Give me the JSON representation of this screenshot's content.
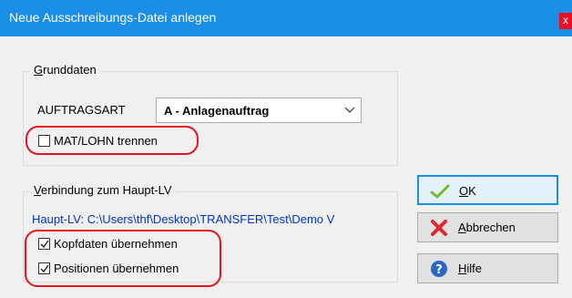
{
  "window": {
    "title": "Neue Ausschreibungs-Datei anlegen",
    "close_label": "x"
  },
  "grunddaten": {
    "legend_mnemonic": "G",
    "legend_rest": "runddaten",
    "auftragsart_label": "AUFTRAGSART",
    "auftragsart_value": "A - Anlagenauftrag",
    "mat_lohn_label": "MAT/LOHN trennen",
    "mat_lohn_checked": false
  },
  "verbindung": {
    "legend_mnemonic": "V",
    "legend_rest": "erbindung zum Haupt-LV",
    "haupt_lv_path": "Haupt-LV: C:\\Users\\thf\\Desktop\\TRANSFER\\Test\\Demo V",
    "kopfdaten_label": "Kopfdaten übernehmen",
    "kopfdaten_checked": true,
    "positionen_label": "Positionen übernehmen",
    "positionen_checked": true
  },
  "buttons": {
    "ok_mnemonic": "O",
    "ok_rest": "K",
    "abbrechen_mnemonic": "A",
    "abbrechen_rest": "bbrechen",
    "hilfe_mnemonic": "H",
    "hilfe_rest": "ilfe"
  },
  "colors": {
    "titlebar": "#1b8ee8",
    "annotation_red": "#e8131f",
    "link_blue": "#0033cc"
  }
}
